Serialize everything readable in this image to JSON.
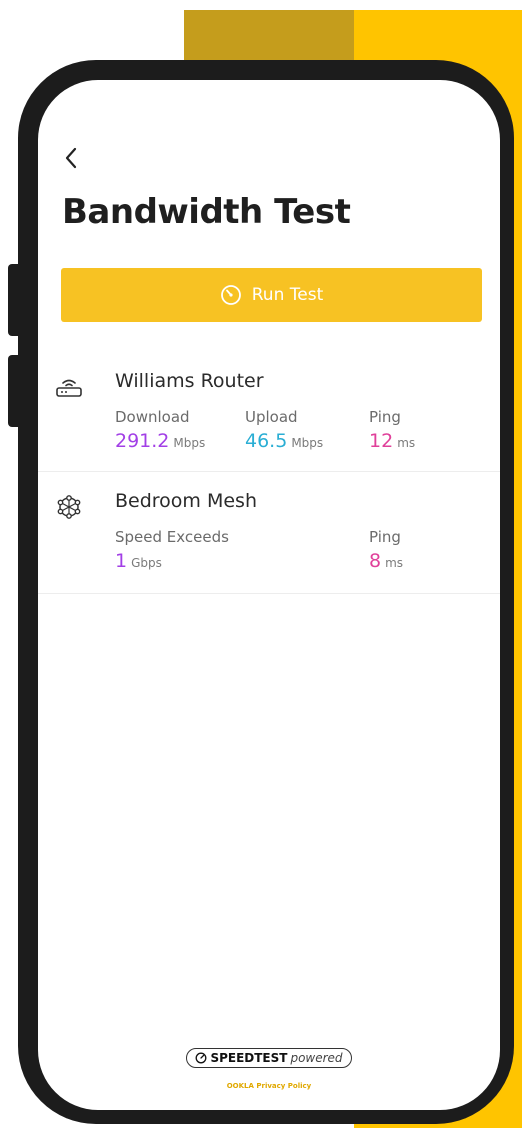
{
  "header": {
    "title": "Bandwidth Test"
  },
  "run_button": {
    "label": "Run Test"
  },
  "devices": [
    {
      "name": "Williams Router",
      "icon": "router-icon",
      "metrics": [
        {
          "label": "Download",
          "value": "291.2",
          "unit": "Mbps"
        },
        {
          "label": "Upload",
          "value": "46.5",
          "unit": "Mbps"
        },
        {
          "label": "Ping",
          "value": "12",
          "unit": "ms"
        }
      ]
    },
    {
      "name": "Bedroom Mesh",
      "icon": "mesh-icon",
      "metrics": [
        {
          "label": "Speed Exceeds",
          "value": "1",
          "unit": "Gbps"
        },
        {
          "label": "Ping",
          "value": "8",
          "unit": "ms"
        }
      ]
    }
  ],
  "footer": {
    "badge_brand": "SPEEDTEST",
    "badge_suffix": "powered",
    "links": "OOKLA Privacy Policy"
  },
  "colors": {
    "accent": "#f7c223",
    "download": "#a23fe6",
    "upload": "#2aaed4",
    "ping": "#e0409a"
  }
}
